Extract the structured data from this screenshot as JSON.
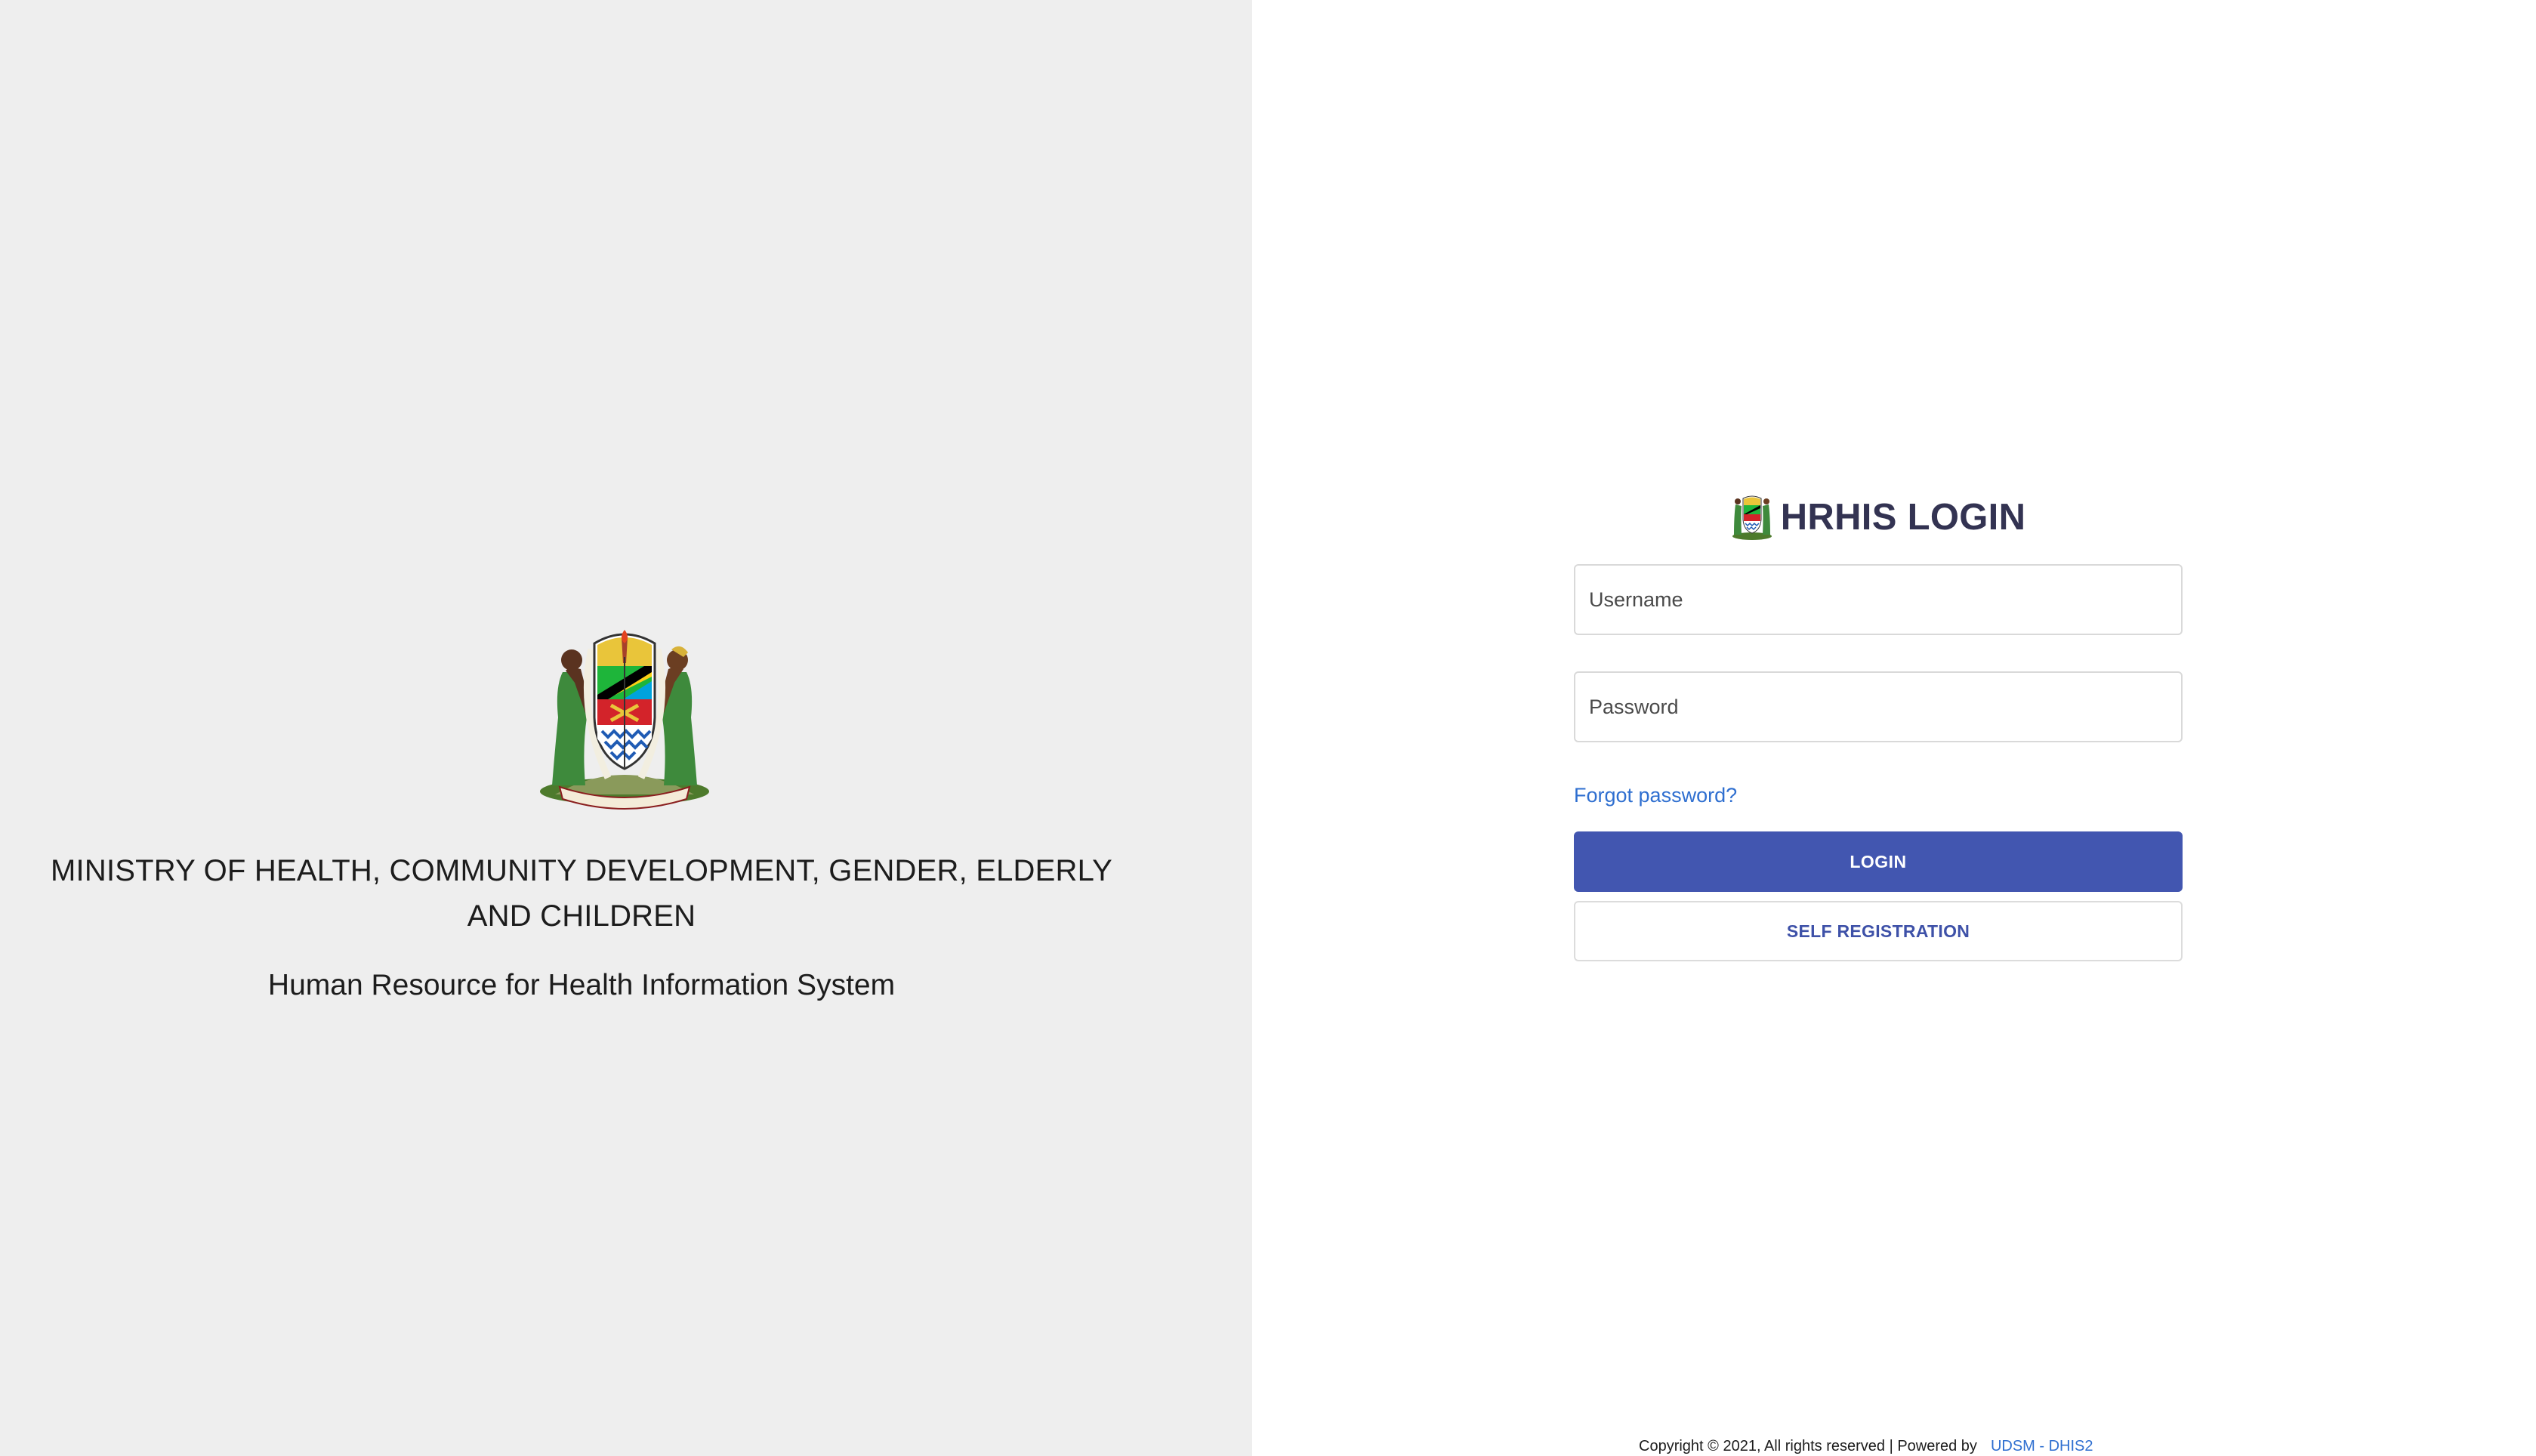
{
  "left_panel": {
    "ministry_title": "MINISTRY OF HEALTH, COMMUNITY DEVELOPMENT, GENDER, ELDERLY AND CHILDREN",
    "system_subtitle": "Human Resource for Health Information System",
    "emblem_icon": "tanzania-coat-of-arms-icon",
    "background_color": "#eeeeee"
  },
  "login_form": {
    "heading": "HRHIS LOGIN",
    "heading_icon": "tanzania-coat-of-arms-icon",
    "username_placeholder": "Username",
    "password_placeholder": "Password",
    "forgot_password_label": "Forgot password?",
    "login_button_label": "LOGIN",
    "self_registration_label": "SELF REGISTRATION",
    "primary_color": "#4256b0",
    "link_color": "#2f6fd0"
  },
  "footer": {
    "copyright_text": "Copyright © 2021, All rights reserved | Powered by",
    "powered_by_link": "UDSM - DHIS2"
  }
}
